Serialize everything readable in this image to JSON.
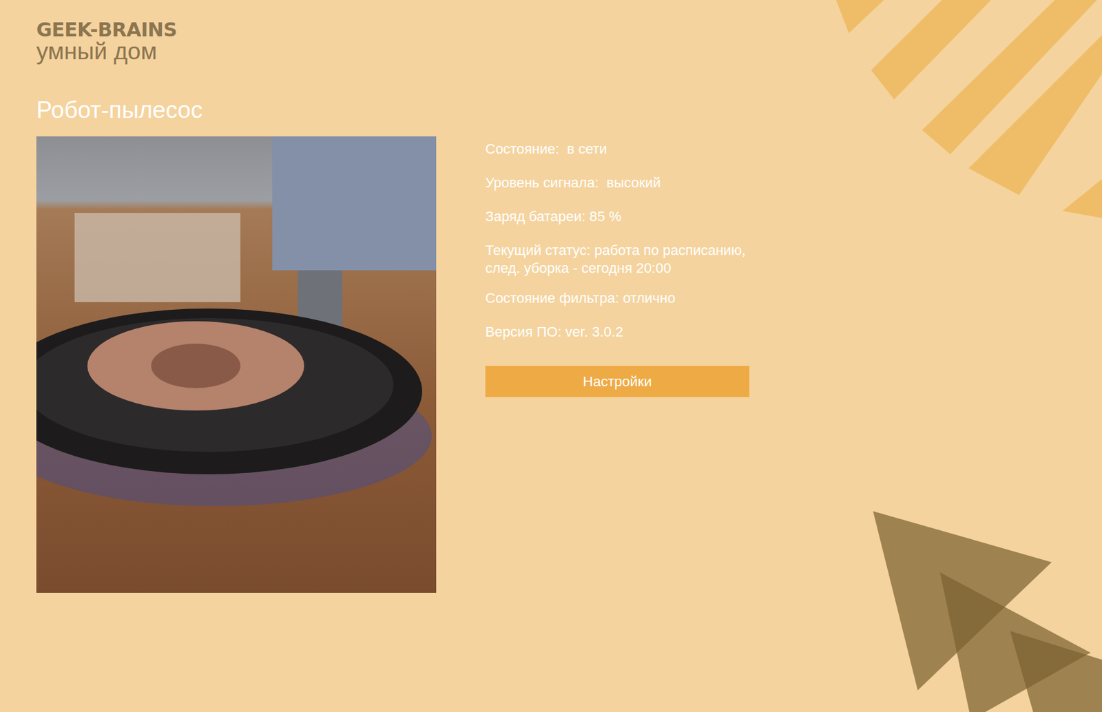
{
  "logo": {
    "brand": "GEEK-BRAINS",
    "subtitle": "умный дом"
  },
  "device": {
    "title": "Робот-пылесос"
  },
  "info": [
    {
      "lines": [
        "Состояние:  в сети"
      ]
    },
    {
      "lines": [
        "Уровень сигнала:  высокий"
      ]
    },
    {
      "lines": [
        "Заряд батареи: 85 %"
      ]
    },
    {
      "lines": [
        "Текущий статус: работа по расписанию,",
        "след. уборка - сегодня 20:00"
      ]
    },
    {
      "lines": [
        "Состояние фильтра: отлично"
      ]
    },
    {
      "lines": [
        "Версия ПО: ver. 3.0.2"
      ]
    }
  ],
  "button": "Настройки"
}
